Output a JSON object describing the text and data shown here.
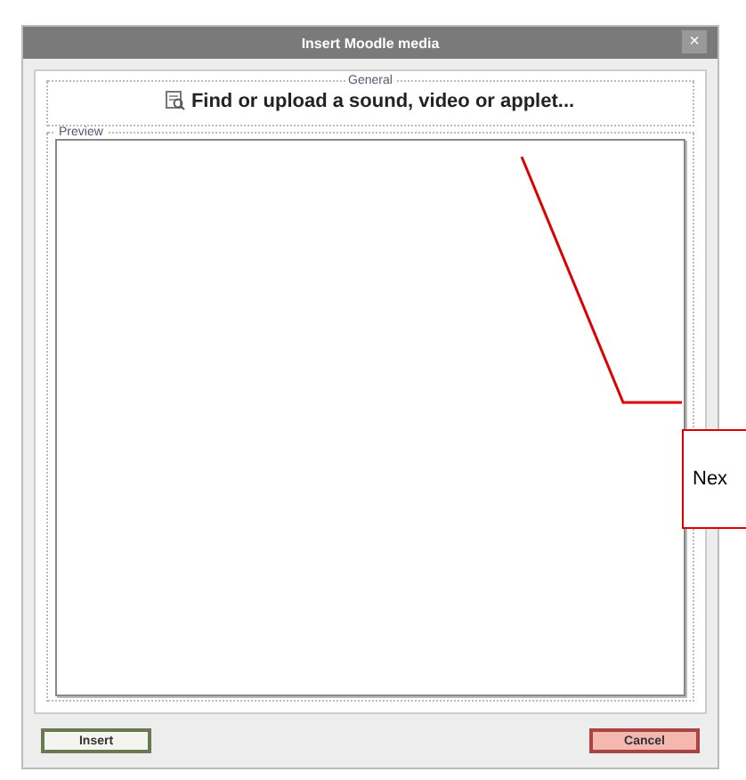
{
  "dialog": {
    "title": "Insert Moodle media",
    "close": "×"
  },
  "general": {
    "legend": "General",
    "link": "Find or upload a sound, video or applet..."
  },
  "preview": {
    "legend": "Preview"
  },
  "buttons": [
    {
      "label": "Insert",
      "kind": "insert"
    },
    {
      "label": "Cancel",
      "kind": "cancel"
    }
  ],
  "callout": {
    "text": "Nex"
  }
}
